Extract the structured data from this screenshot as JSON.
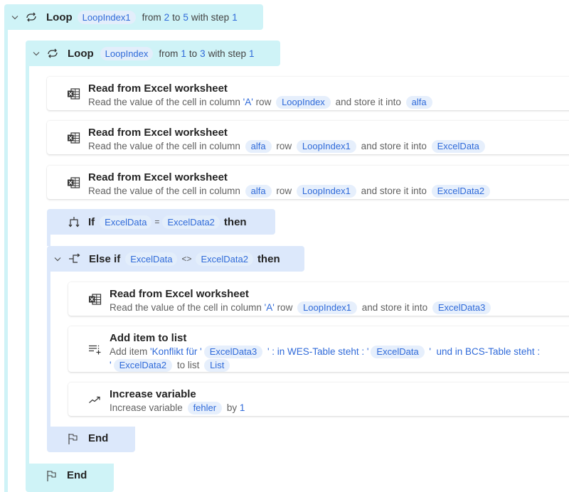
{
  "outer_loop": {
    "keyword": "Loop",
    "index_variable": "LoopIndex1",
    "from_label": "from",
    "start": "2",
    "to_label": "to",
    "end": "5",
    "step_label": "with step",
    "step": "1"
  },
  "inner_loop": {
    "keyword": "Loop",
    "index_variable": "LoopIndex",
    "from_label": "from",
    "start": "1",
    "to_label": "to",
    "end": "3",
    "step_label": "with step",
    "step": "1",
    "end_label": "End"
  },
  "actions": [
    {
      "icon": "excel-icon",
      "title": "Read from Excel worksheet",
      "description": [
        {
          "type": "text",
          "text": "Read the value of the cell in column "
        },
        {
          "type": "literal",
          "text": "'A'"
        },
        {
          "type": "text",
          "text": " row "
        },
        {
          "type": "var",
          "text": "LoopIndex"
        },
        {
          "type": "text",
          "text": " and store it into "
        },
        {
          "type": "var",
          "text": "alfa"
        }
      ]
    },
    {
      "icon": "excel-icon",
      "title": "Read from Excel worksheet",
      "description": [
        {
          "type": "text",
          "text": "Read the value of the cell in column "
        },
        {
          "type": "var",
          "text": "alfa"
        },
        {
          "type": "text",
          "text": " row "
        },
        {
          "type": "var",
          "text": "LoopIndex1"
        },
        {
          "type": "text",
          "text": " and store it into "
        },
        {
          "type": "var",
          "text": "ExcelData"
        }
      ]
    },
    {
      "icon": "excel-icon",
      "title": "Read from Excel worksheet",
      "description": [
        {
          "type": "text",
          "text": "Read the value of the cell in column "
        },
        {
          "type": "var",
          "text": "alfa"
        },
        {
          "type": "text",
          "text": " row "
        },
        {
          "type": "var",
          "text": "LoopIndex1"
        },
        {
          "type": "text",
          "text": " and store it into "
        },
        {
          "type": "var",
          "text": "ExcelData2"
        }
      ]
    },
    {
      "icon": "excel-icon",
      "title": "Read from Excel worksheet",
      "description": [
        {
          "type": "text",
          "text": "Read the value of the cell in column "
        },
        {
          "type": "literal",
          "text": "'A'"
        },
        {
          "type": "text",
          "text": " row "
        },
        {
          "type": "var",
          "text": "LoopIndex1"
        },
        {
          "type": "text",
          "text": " and store it into "
        },
        {
          "type": "var",
          "text": "ExcelData3"
        }
      ]
    },
    {
      "icon": "add-to-list-icon",
      "title": "Add item to list",
      "description": [
        {
          "type": "text",
          "text": "Add item "
        },
        {
          "type": "literal",
          "text": "'Konflikt für '"
        },
        {
          "type": "var",
          "text": "ExcelData3"
        },
        {
          "type": "literal",
          "text": " ' : in WES-Table steht : '"
        },
        {
          "type": "var",
          "text": "ExcelData"
        },
        {
          "type": "literal",
          "text": " '  und in BCS-Table steht : '"
        },
        {
          "type": "var",
          "text": "ExcelData2"
        },
        {
          "type": "text",
          "text": " to list "
        },
        {
          "type": "var",
          "text": "List"
        }
      ]
    },
    {
      "icon": "increase-variable-icon",
      "title": "Increase variable",
      "description": [
        {
          "type": "text",
          "text": "Increase variable "
        },
        {
          "type": "var",
          "text": "fehler"
        },
        {
          "type": "text",
          "text": " by "
        },
        {
          "type": "literal",
          "text": "1"
        }
      ]
    }
  ],
  "if_block": {
    "keyword": "If",
    "left_operand": "ExcelData",
    "operator": "=",
    "right_operand": "ExcelData2",
    "then_label": "then"
  },
  "else_if_block": {
    "keyword": "Else if",
    "left_operand": "ExcelData",
    "operator": "<>",
    "right_operand": "ExcelData2",
    "then_label": "then"
  },
  "if_end": {
    "label": "End"
  },
  "colors": {
    "loop_block": "#cff3f7",
    "condition_block": "#dce8fb",
    "variable_pill_bg": "#e6effc",
    "accent_blue": "#2f6ad9",
    "title_text": "#242424",
    "description_text": "#616161"
  }
}
